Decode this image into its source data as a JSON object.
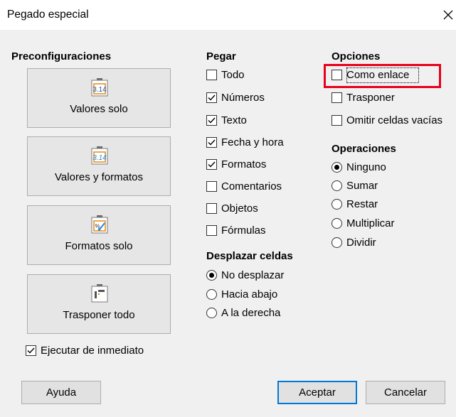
{
  "dialog": {
    "title": "Pegado especial"
  },
  "presets": {
    "heading": "Preconfiguraciones",
    "items": [
      {
        "label": "Valores solo",
        "icon": "values-only-paste-icon"
      },
      {
        "label": "Valores y formatos",
        "icon": "values-formats-paste-icon"
      },
      {
        "label": "Formatos solo",
        "icon": "formats-only-paste-icon"
      },
      {
        "label": "Trasponer todo",
        "icon": "transpose-all-paste-icon"
      }
    ],
    "run_immediately": {
      "label": "Ejecutar de inmediato",
      "checked": true
    }
  },
  "paste": {
    "heading": "Pegar",
    "options": [
      {
        "label": "Todo",
        "checked": false
      },
      {
        "label": "Números",
        "checked": true
      },
      {
        "label": "Texto",
        "checked": true
      },
      {
        "label": "Fecha y hora",
        "checked": true
      },
      {
        "label": "Formatos",
        "checked": true
      },
      {
        "label": "Comentarios",
        "checked": false
      },
      {
        "label": "Objetos",
        "checked": false
      },
      {
        "label": "Fórmulas",
        "checked": false
      }
    ]
  },
  "shift_cells": {
    "heading": "Desplazar celdas",
    "options": [
      {
        "label": "No desplazar",
        "selected": true
      },
      {
        "label": "Hacia abajo",
        "selected": false
      },
      {
        "label": "A la derecha",
        "selected": false
      }
    ]
  },
  "options": {
    "heading": "Opciones",
    "items": [
      {
        "label": "Como enlace",
        "checked": false
      },
      {
        "label": "Trasponer",
        "checked": false
      },
      {
        "label": "Omitir celdas vacías",
        "checked": false
      }
    ]
  },
  "operations": {
    "heading": "Operaciones",
    "options": [
      {
        "label": "Ninguno",
        "selected": true
      },
      {
        "label": "Sumar",
        "selected": false
      },
      {
        "label": "Restar",
        "selected": false
      },
      {
        "label": "Multiplicar",
        "selected": false
      },
      {
        "label": "Dividir",
        "selected": false
      }
    ]
  },
  "buttons": {
    "help": "Ayuda",
    "ok": "Aceptar",
    "cancel": "Cancelar"
  },
  "colors": {
    "highlight": "#e8001c",
    "accent": "#0078d7"
  }
}
